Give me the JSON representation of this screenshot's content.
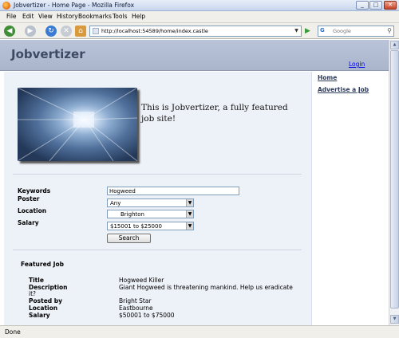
{
  "window": {
    "title": "Jobvertizer - Home Page - Mozilla Firefox"
  },
  "menu": [
    "File",
    "Edit",
    "View",
    "History",
    "Bookmarks",
    "Tools",
    "Help"
  ],
  "toolbar": {
    "url": "http://localhost:54589/home/index.castle",
    "search_placeholder": "Google",
    "search_engine": "G"
  },
  "site": {
    "logo": "Jobvertizer",
    "login": "Login",
    "tagline": "This is Jobvertizer, a fully featured job site!"
  },
  "sidebar": {
    "items": [
      "Home",
      "Advertise a Job"
    ]
  },
  "search_form": {
    "keywords_label": "Keywords",
    "keywords_value": "Hogweed",
    "poster_label": "Poster",
    "poster_value": "Any",
    "location_label": "Location",
    "location_value": "Brighton",
    "salary_label": "Salary",
    "salary_value": "$15001 to $25000",
    "search_button": "Search"
  },
  "featured": {
    "heading": "Featured Job",
    "title_label": "Title",
    "title_value": "Hogweed Killer",
    "description_label": "Description",
    "description_value": "Giant Hogweed is threatening mankind. Help us eradicate",
    "description_wrap": "it?",
    "posted_by_label": "Posted by",
    "posted_by_value": "Bright Star",
    "location_label": "Location",
    "location_value": "Eastbourne",
    "salary_label": "Salary",
    "salary_value": "$50001 to $75000"
  },
  "status": {
    "text": "Done"
  },
  "colors": {
    "header": "#aab5cc",
    "content_bg": "#edf1f8",
    "link": "#0000ee"
  }
}
